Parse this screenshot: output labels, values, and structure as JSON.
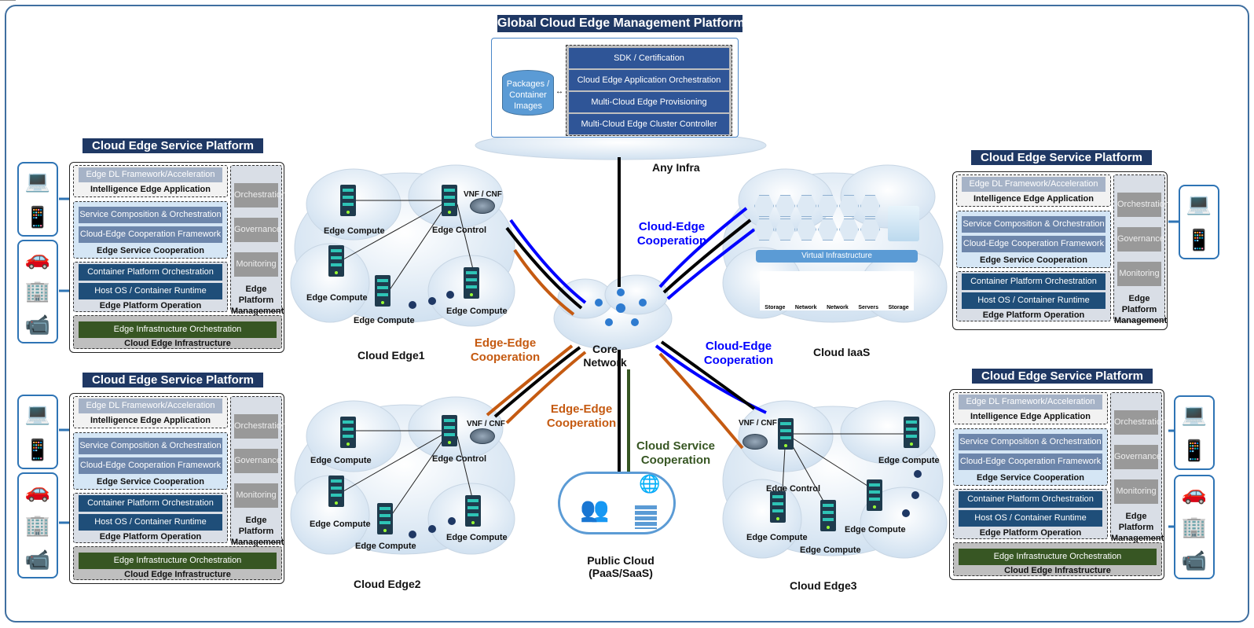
{
  "global": {
    "title": "Global Cloud Edge Management Platform",
    "db": "Packages / Container Images",
    "items": [
      "SDK / Certification",
      "Cloud Edge Application Orchestration",
      "Multi-Cloud Edge Provisioning",
      "Multi-Cloud Edge Cluster Controller"
    ],
    "any_infra": "Any Infra"
  },
  "platform": {
    "title": "Cloud Edge Service Platform",
    "dl": "Edge DL Framework/Acceleration",
    "iea": "Intelligence Edge Application",
    "sco": "Service Composition & Orchestration",
    "cecf": "Cloud-Edge Cooperation Framework",
    "esc": "Edge Service Cooperation",
    "cpo": "Container Platform Orchestration",
    "host": "Host OS / Container Runtime",
    "epo": "Edge Platform Operation",
    "orch": "Orchestration",
    "gov": "Governance",
    "mon": "Monitoring",
    "epm": "Edge Platform Management",
    "eio": "Edge Infrastructure Orchestration",
    "cei": "Cloud Edge Infrastructure"
  },
  "devices": {
    "mobile": [
      "tablet-icon",
      "smartphone-icon"
    ],
    "iot": [
      "connected-car-icon",
      "smart-building-icon",
      "cctv-camera-icon"
    ]
  },
  "edge": {
    "compute": "Edge Compute",
    "control": "Edge Control",
    "vnf": "VNF / CNF"
  },
  "clouds": {
    "edge1": "Cloud Edge1",
    "edge2": "Cloud Edge2",
    "edge3": "Cloud Edge3",
    "iaas": "Cloud IaaS",
    "public": "Public Cloud (PaaS/SaaS)",
    "core": "Core Network"
  },
  "iaas": {
    "vi": "Virtual Infrastructure",
    "labels": [
      "Storage",
      "Network",
      "Network",
      "Servers",
      "Storage"
    ]
  },
  "coop": {
    "ce1": "Cloud-Edge Cooperation",
    "ee1": "Edge-Edge Cooperation",
    "ce2": "Cloud-Edge Cooperation",
    "ee2": "Edge-Edge Cooperation",
    "cs": "Cloud Service Cooperation"
  },
  "colors": {
    "cloud_edge": "#0000ff",
    "edge_edge": "#c55a11",
    "cloud_service": "#375623",
    "title_bg": "#1f3864"
  }
}
